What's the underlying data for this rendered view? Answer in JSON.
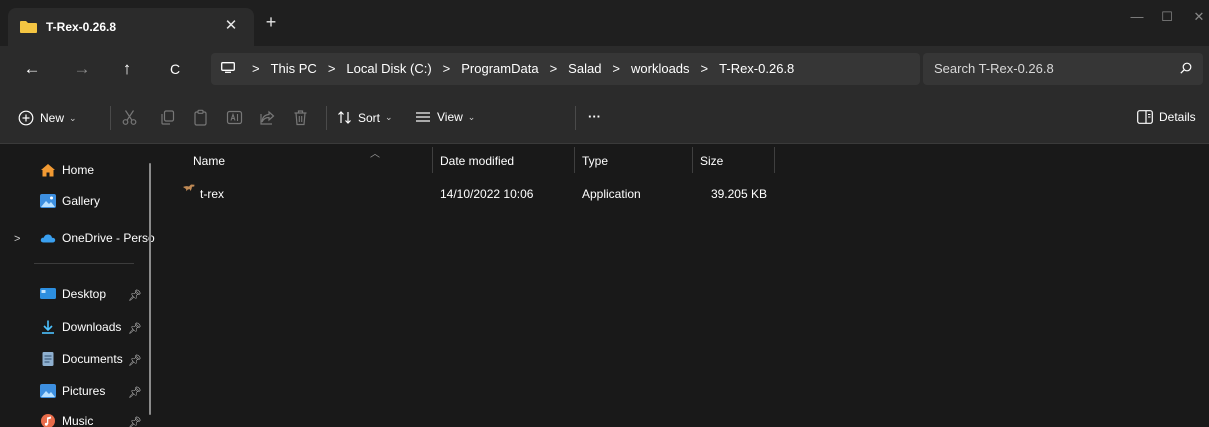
{
  "tab": {
    "title": "T-Rex-0.26.8",
    "close": "✕",
    "new": "+"
  },
  "window": {
    "minimize": "—",
    "maximize": "☐",
    "close": "✕"
  },
  "nav": {
    "back": "←",
    "forward": "→",
    "up": "↑",
    "refresh": "C"
  },
  "breadcrumb": [
    "This PC",
    "Local Disk (C:)",
    "ProgramData",
    "Salad",
    "workloads",
    "T-Rex-0.26.8"
  ],
  "breadcrumb_sep": ">",
  "search": {
    "placeholder": "Search T-Rex-0.26.8"
  },
  "toolbar": {
    "new_label": "New",
    "sort_label": "Sort",
    "view_label": "View",
    "more_label": "···",
    "details_label": "Details"
  },
  "sidebar": {
    "home": "Home",
    "gallery": "Gallery",
    "onedrive": "OneDrive - Perso",
    "quick": [
      {
        "label": "Desktop",
        "icon": "desktop-icon"
      },
      {
        "label": "Downloads",
        "icon": "download-icon"
      },
      {
        "label": "Documents",
        "icon": "document-icon"
      },
      {
        "label": "Pictures",
        "icon": "picture-icon"
      },
      {
        "label": "Music",
        "icon": "music-icon"
      }
    ]
  },
  "columns": {
    "name": "Name",
    "date": "Date modified",
    "type": "Type",
    "size": "Size"
  },
  "files": [
    {
      "name": "t-rex",
      "date": "14/10/2022 10:06",
      "type": "Application",
      "size": "39.205 KB",
      "icon": "t-rex-app-icon"
    }
  ],
  "colors": {
    "bg": "#191919",
    "chrome": "#2b2b2b",
    "field": "#363636",
    "folder": "#f4c542",
    "accent": "#4cc2ff"
  }
}
